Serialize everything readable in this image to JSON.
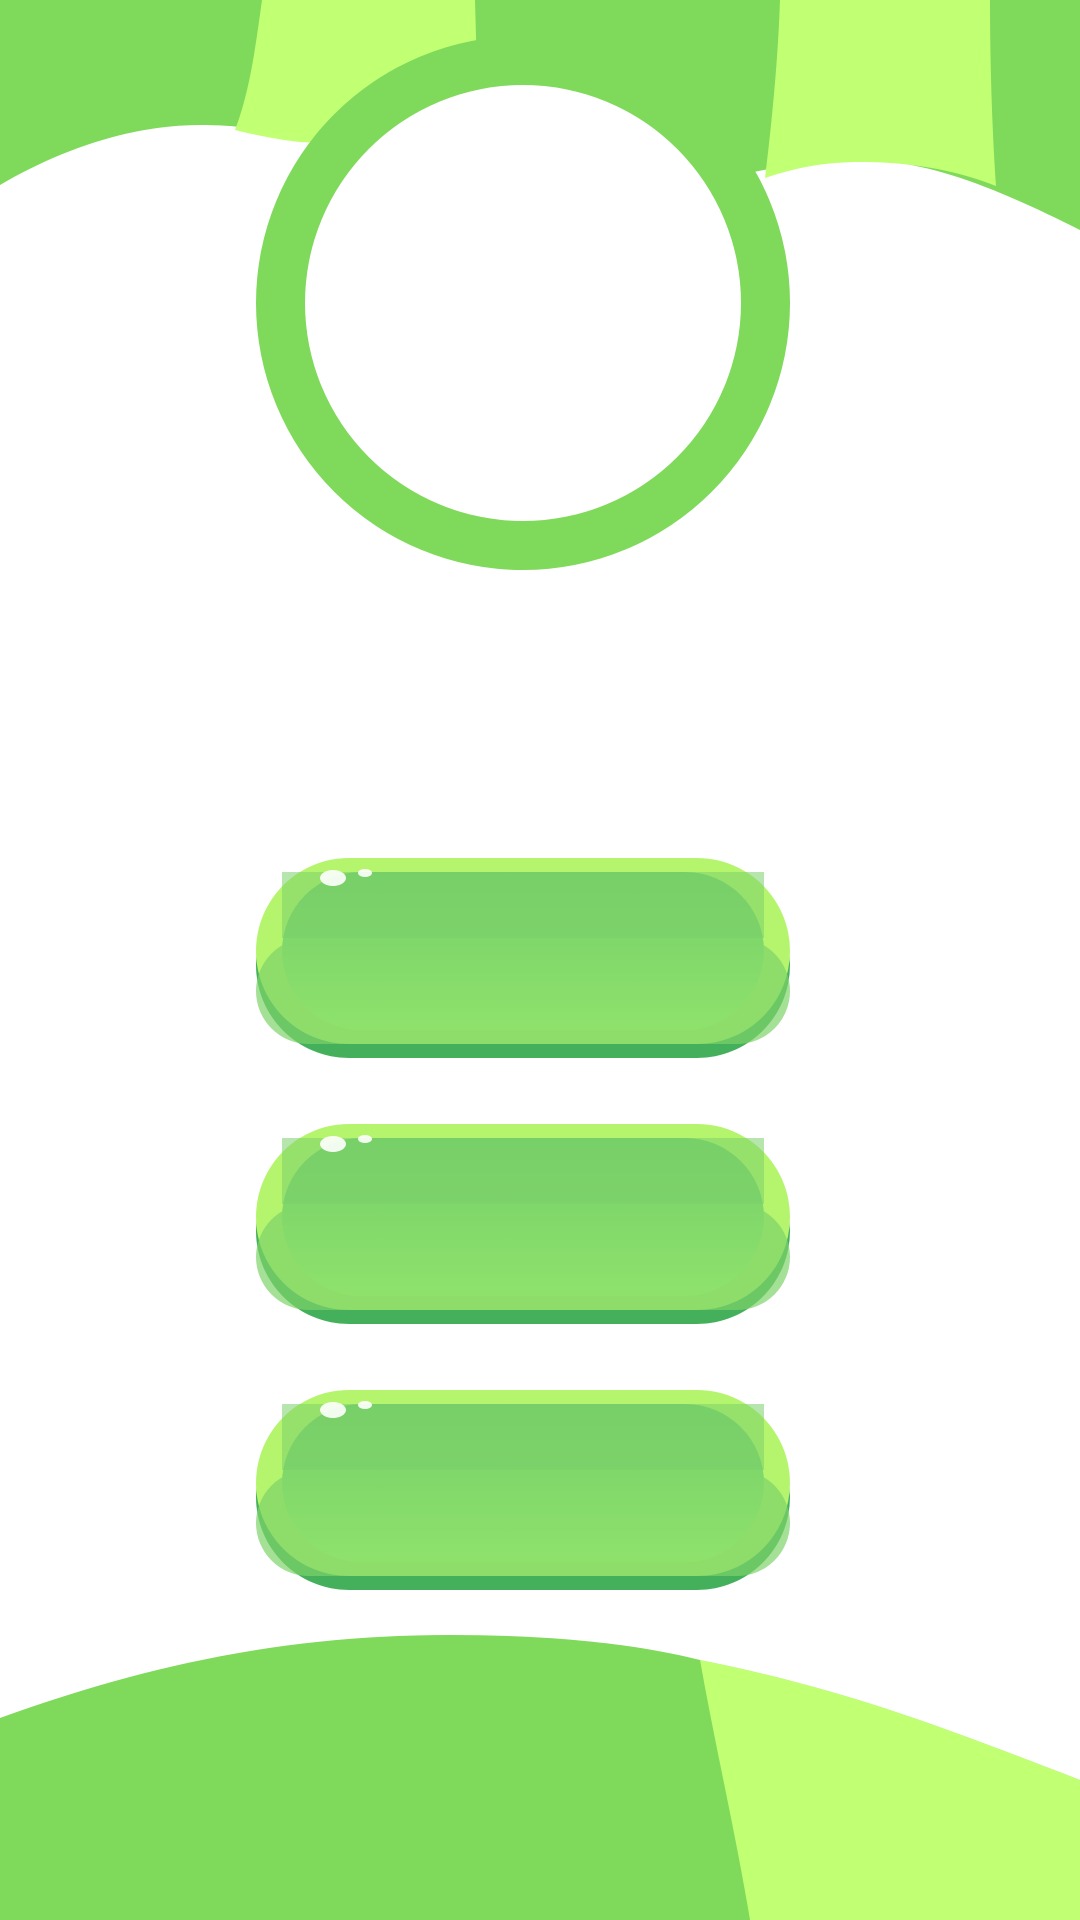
{
  "app": {
    "title": ""
  },
  "profile": {
    "avatar_icon": "avatar-placeholder-icon"
  },
  "menu": {
    "buttons": [
      {
        "label": ""
      },
      {
        "label": ""
      },
      {
        "label": ""
      }
    ]
  },
  "colors": {
    "background": "#ffffff",
    "leaf_dark": "#7fd95a",
    "leaf_light": "#c1ff73",
    "button_top": "#7fd86c",
    "button_bottom": "#8ee26c",
    "button_rim": "#b5f56e",
    "button_shadow": "#45b05c"
  }
}
